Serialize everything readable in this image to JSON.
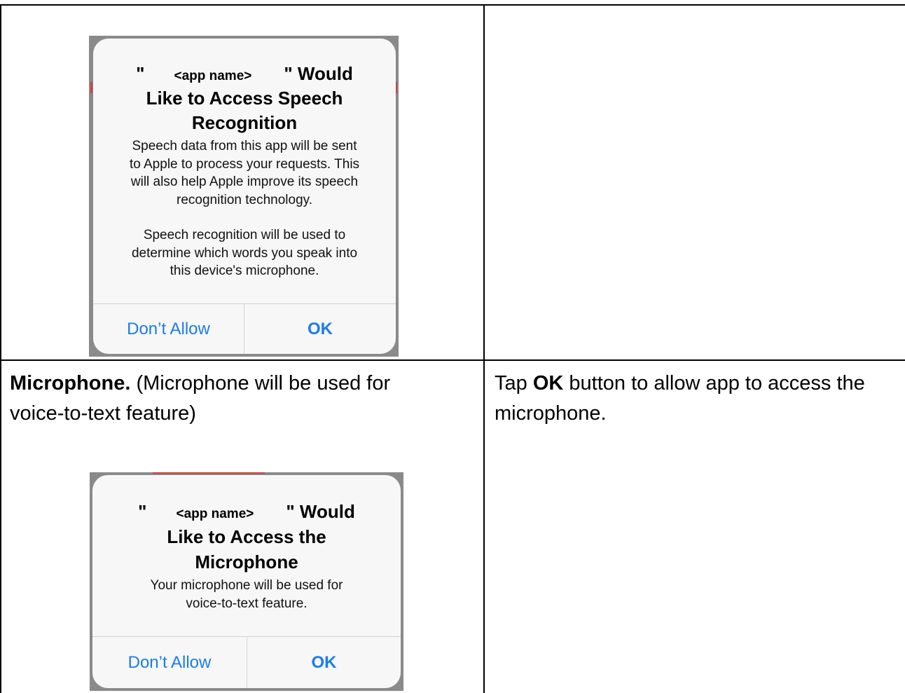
{
  "rows": [
    {
      "left_cell": {
        "heading": "",
        "alert": {
          "title_quote_open": "\"",
          "title_app": "<app name>",
          "title_quote_close": "\" Would",
          "title_line2": "Like to Access Speech",
          "title_line3": "Recognition",
          "message_lines": [
            "Speech data from this app will be sent",
            "to Apple to process your requests. This",
            "will also help Apple improve its speech",
            "recognition technology.",
            "",
            "Speech recognition will be used to",
            "determine which words you speak into",
            "this device's microphone."
          ],
          "buttons": {
            "left": "Don’t Allow",
            "right": "OK"
          }
        }
      },
      "right_cell": {
        "text": ""
      }
    },
    {
      "left_cell": {
        "heading_bold": "Microphone.",
        "heading_rest": " (Microphone will be used for",
        "heading_line2": "voice-to-text feature)",
        "alert": {
          "title_quote_open": "\"",
          "title_app": "<app name>",
          "title_quote_close": "\" Would",
          "title_line2": "Like to Access the",
          "title_line3": "Microphone",
          "message_lines": [
            "Your microphone will be used for",
            "voice-to-text feature."
          ],
          "buttons": {
            "left": "Don’t Allow",
            "right": "OK"
          }
        }
      },
      "right_cell": {
        "prefix": "Tap ",
        "bold": "OK",
        "suffix": " button to allow app to access the",
        "line2": "microphone."
      }
    }
  ],
  "colors": {
    "ios_blue": "#1a7cf0",
    "alert_background": "#f7f7f7",
    "screenshot_dim": "#8a8a8a",
    "table_border": "#000000"
  }
}
